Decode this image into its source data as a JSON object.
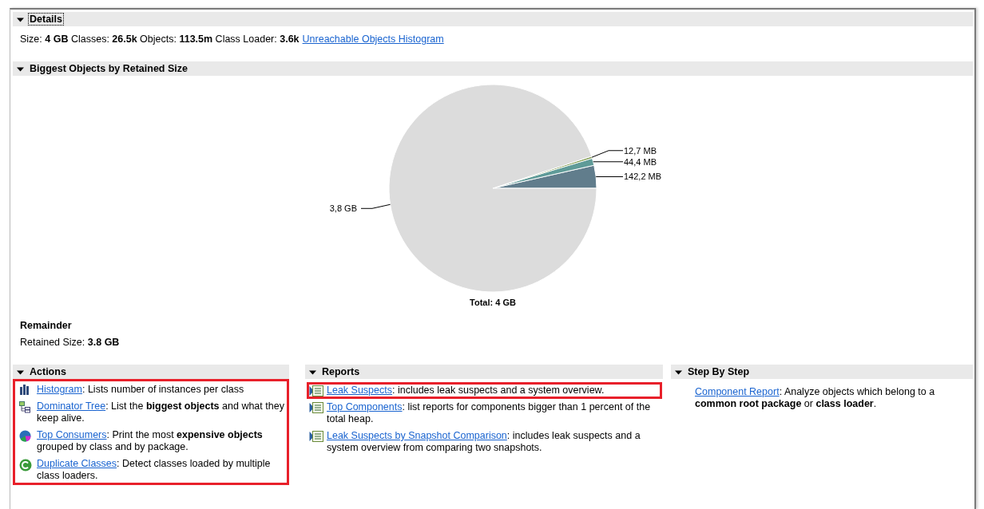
{
  "details": {
    "title": "Details",
    "expanded": true,
    "focused": true,
    "summary": "Size: **4 GB** Classes: **26.5k** Objects: **113.5m** Class Loader: **3.6k**",
    "link": "Unreachable Objects Histogram"
  },
  "biggest_objects": {
    "title": "Biggest Objects by Retained Size",
    "expanded": true,
    "focused": false,
    "chart_data": {
      "type": "pie",
      "title": "Total: 4 GB",
      "values": [
        3.56,
        1.11,
        0.32,
        95.01
      ],
      "colors": [
        "#617d8c",
        "#5f9b98",
        "#7f9a4e",
        "#dcdcdc"
      ],
      "annotations": [
        {
          "text": "142,2 MB"
        },
        {
          "text": "44,4 MB"
        },
        {
          "text": "12,7 MB"
        },
        {
          "text": "3,8 GB"
        }
      ]
    },
    "remainder": {
      "title": "Remainder",
      "retained_size": "Retained Size: **3.8 GB**"
    }
  },
  "actions": {
    "title": "Actions",
    "expanded": true,
    "focused": false,
    "highlighted": true,
    "items": [
      {
        "kind": "histogram",
        "link": "Histogram",
        "text": ": Lists number of instances per class"
      },
      {
        "kind": "tree",
        "link": "Dominator Tree",
        "text": ": List the **biggest objects** and what they keep alive."
      },
      {
        "kind": "consumers",
        "link": "Top Consumers",
        "text": ": Print the most **expensive objects** grouped by class and by package."
      },
      {
        "kind": "duplicates",
        "link": "Duplicate Classes",
        "text": ": Detect classes loaded by multiple class loaders."
      }
    ]
  },
  "reports": {
    "title": "Reports",
    "expanded": true,
    "focused": false,
    "items": [
      {
        "kind": "report",
        "link": "Leak Suspects",
        "text": ": includes leak suspects and a system overview.",
        "highlighted": true
      },
      {
        "kind": "report",
        "link": "Top Components",
        "text": ": list reports for components bigger than 1 percent of the total heap.",
        "highlighted": false
      },
      {
        "kind": "report",
        "link": "Leak Suspects by Snapshot Comparison",
        "text": ": includes leak suspects and a system overview from comparing two snapshots.",
        "highlighted": false
      }
    ]
  },
  "step_by_step": {
    "title": "Step By Step",
    "expanded": true,
    "focused": false,
    "items": [
      {
        "kind": "plain",
        "link": "Component Report",
        "text": ": Analyze objects which belong to a **common root package** or **class loader**."
      }
    ]
  }
}
